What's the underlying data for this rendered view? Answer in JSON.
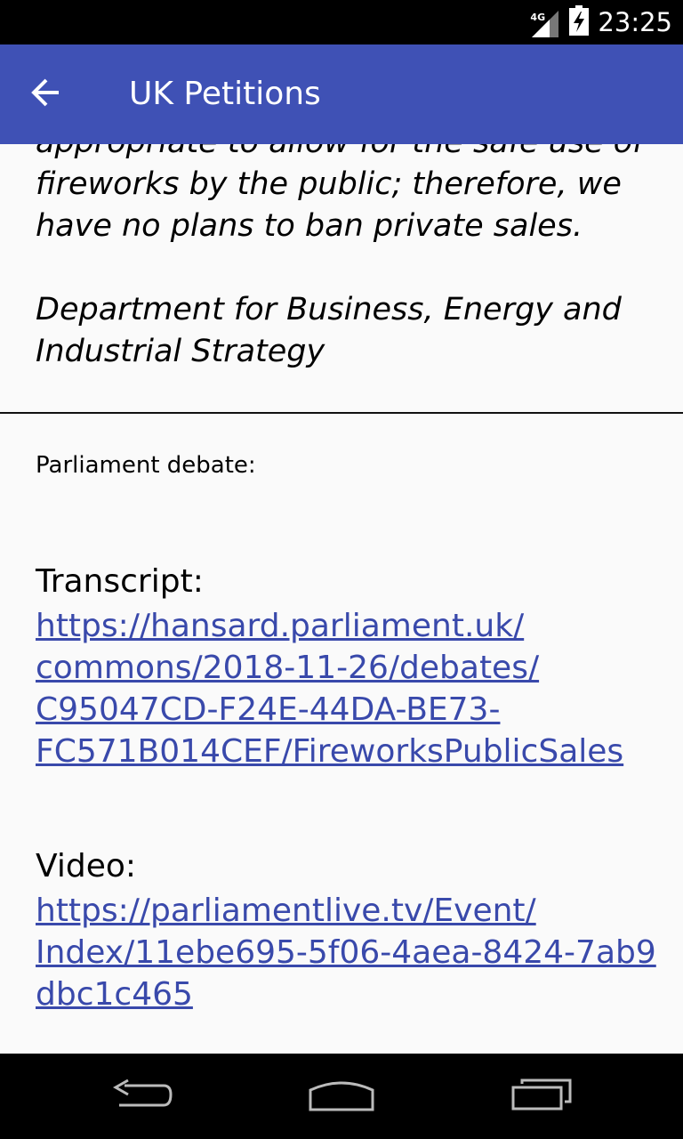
{
  "status_bar": {
    "network": "4G",
    "time": "23:25"
  },
  "app_bar": {
    "title": "UK Petitions"
  },
  "government_response": {
    "text": "appropriate to allow for the safe use of\nfireworks by the public; therefore, we\nhave no plans to ban private sales.\n\nDepartment for Business, Energy and\nIndustrial Strategy"
  },
  "debate": {
    "label": "Parliament debate:",
    "transcript_label": "Transcript:",
    "transcript_url": "https://hansard.parliament.uk/\ncommons/2018-11-26/debates/\nC95047CD-F24E-44DA-BE73-\nFC571B014CEF/FireworksPublicSales",
    "video_label": "Video:",
    "video_url": "https://parliamentlive.tv/Event/\nIndex/11ebe695-5f06-4aea-8424-7ab9\ndbc1c465"
  },
  "colors": {
    "app_bar": "#3f51b5",
    "link": "#3949ab",
    "background": "#fafafa"
  },
  "icons": {
    "back": "arrow-back-icon",
    "signal": "signal-icon",
    "battery": "battery-charging-icon",
    "nav_back": "nav-back-icon",
    "nav_home": "nav-home-icon",
    "nav_recents": "nav-recents-icon"
  }
}
